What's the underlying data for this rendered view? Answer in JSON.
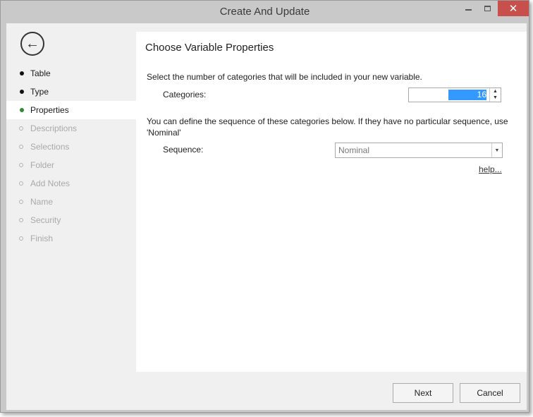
{
  "window": {
    "title": "Create And Update",
    "close_symbol": "✕"
  },
  "sidebar": {
    "back_icon": "←",
    "items": [
      {
        "label": "Table",
        "state": "completed"
      },
      {
        "label": "Type",
        "state": "completed"
      },
      {
        "label": "Properties",
        "state": "active"
      },
      {
        "label": "Descriptions",
        "state": "pending"
      },
      {
        "label": "Selections",
        "state": "pending"
      },
      {
        "label": "Folder",
        "state": "pending"
      },
      {
        "label": "Add Notes",
        "state": "pending"
      },
      {
        "label": "Name",
        "state": "pending"
      },
      {
        "label": "Security",
        "state": "pending"
      },
      {
        "label": "Finish",
        "state": "pending"
      }
    ]
  },
  "main": {
    "heading": "Choose Variable Properties",
    "categories_intro": "Select the number of categories that will be included in your new variable.",
    "categories_label": "Categories:",
    "categories_value": "16",
    "sequence_intro": "You can define the sequence of these categories below. If they have no particular sequence, use 'Nominal'",
    "sequence_label": "Sequence:",
    "sequence_value": "Nominal",
    "help_link": "help..."
  },
  "footer": {
    "next_label": "Next",
    "cancel_label": "Cancel"
  },
  "colors": {
    "active_bullet": "#2e8b2e",
    "close_button": "#c7504d",
    "selection": "#3399ff"
  }
}
